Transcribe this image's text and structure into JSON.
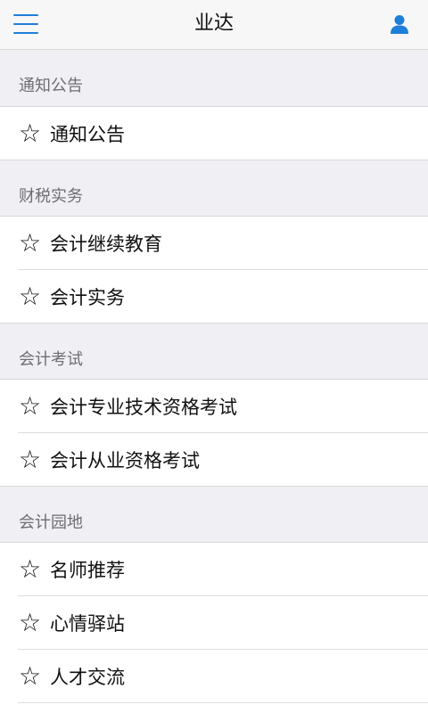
{
  "header": {
    "title": "业达",
    "menu_icon": "hamburger-menu-icon",
    "user_icon": "user-icon",
    "accent_color": "#1e7fd8"
  },
  "sections": [
    {
      "title": "通知公告",
      "items": [
        {
          "label": "通知公告",
          "icon": "star-outline-icon"
        }
      ]
    },
    {
      "title": "财税实务",
      "items": [
        {
          "label": "会计继续教育",
          "icon": "star-outline-icon"
        },
        {
          "label": "会计实务",
          "icon": "star-outline-icon"
        }
      ]
    },
    {
      "title": "会计考试",
      "items": [
        {
          "label": "会计专业技术资格考试",
          "icon": "star-outline-icon"
        },
        {
          "label": "会计从业资格考试",
          "icon": "star-outline-icon"
        }
      ]
    },
    {
      "title": "会计园地",
      "items": [
        {
          "label": "名师推荐",
          "icon": "star-outline-icon"
        },
        {
          "label": "心情驿站",
          "icon": "star-outline-icon"
        },
        {
          "label": "人才交流",
          "icon": "star-outline-icon"
        }
      ]
    }
  ]
}
